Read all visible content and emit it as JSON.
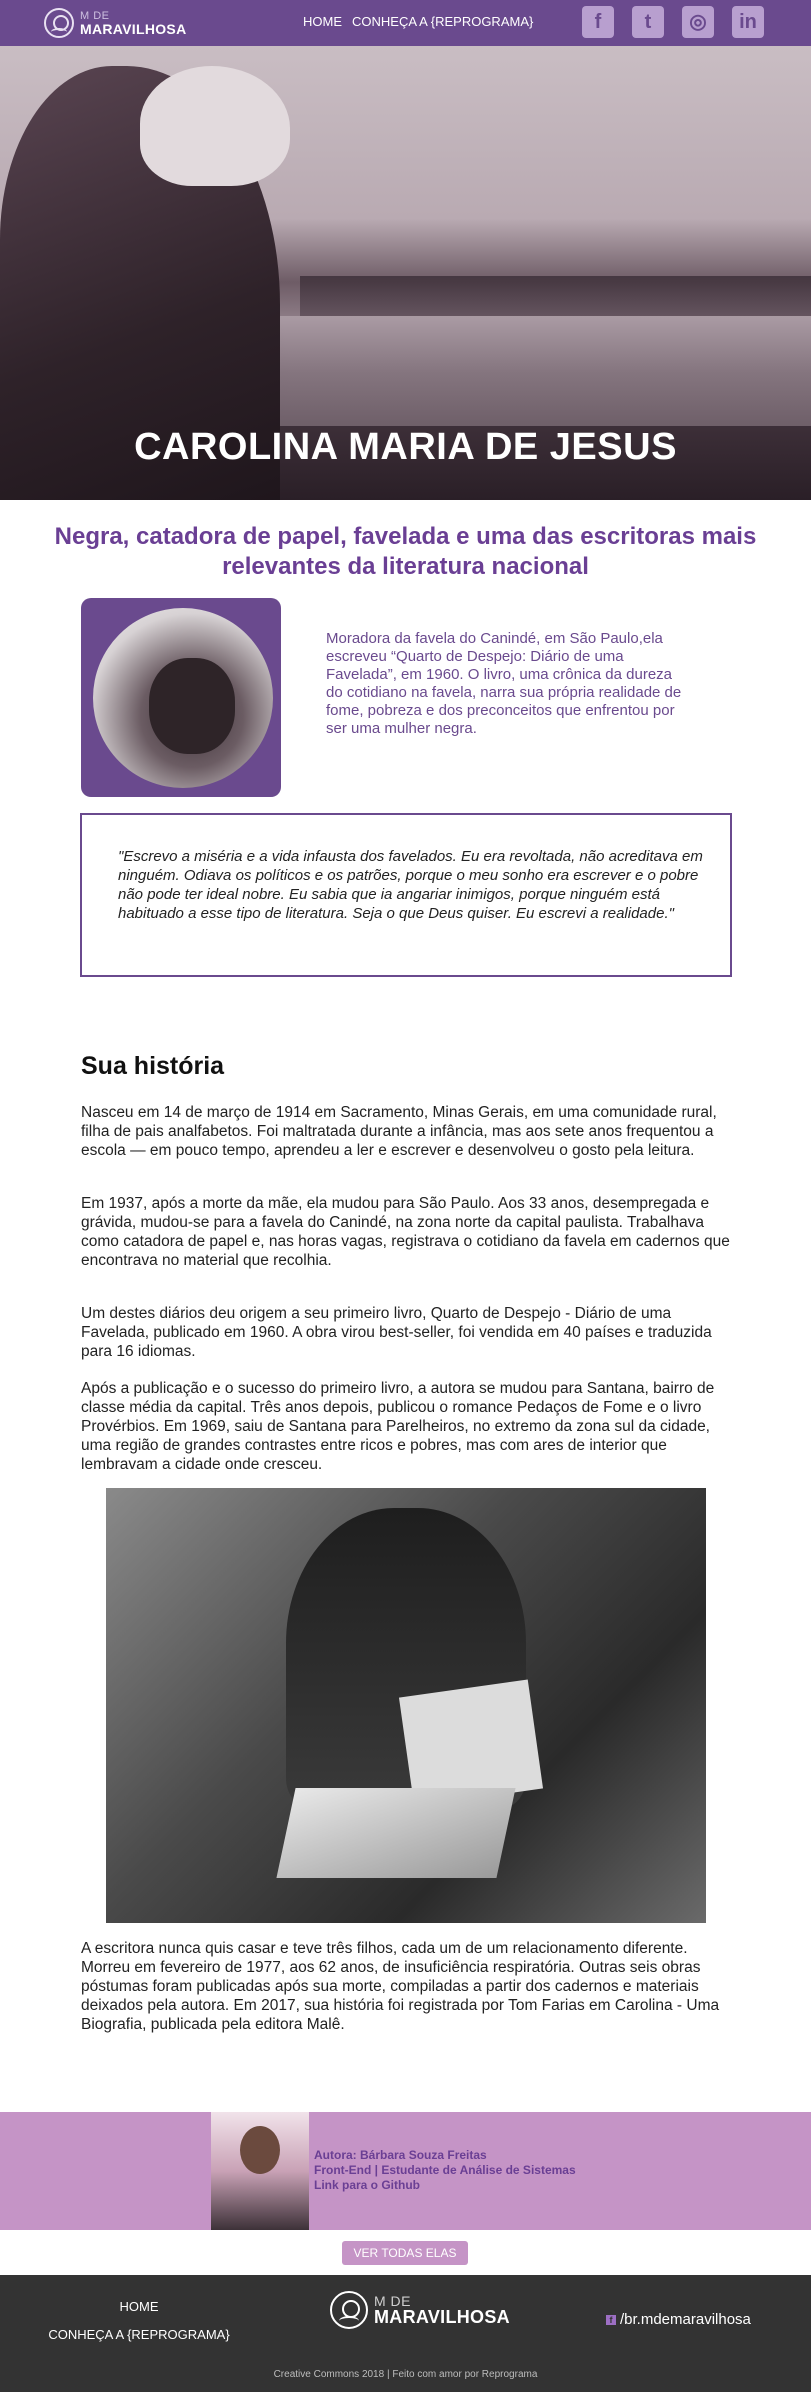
{
  "nav": {
    "logo_small": "M DE",
    "logo_big": "MARAVILHOSA",
    "links": [
      "HOME",
      "CONHEÇA A {REPROGRAMA}"
    ],
    "social_icons": [
      "facebook-icon",
      "twitter-icon",
      "instagram-icon",
      "linkedin-icon"
    ]
  },
  "hero": {
    "title": "CAROLINA MARIA DE JESUS"
  },
  "subtitle": "Negra, catadora de papel, favelada e uma das escritoras mais relevantes da literatura nacional",
  "intro": "Moradora da favela do Canindé, em São Paulo,ela escreveu “Quarto de Despejo: Diário de uma Favelada”, em 1960. O livro, uma crônica da dureza do cotidiano na favela, narra sua própria realidade de fome, pobreza e dos preconceitos que enfrentou por ser uma mulher negra.",
  "quote": "\"Escrevo a miséria e a vida infausta dos favelados. Eu era revoltada, não acreditava em ninguém. Odiava os políticos e os patrões, porque o meu sonho era escrever e o pobre não pode ter ideal nobre. Eu sabia que ia angariar inimigos, porque ninguém está habituado a esse tipo de literatura. Seja o que Deus quiser. Eu escrevi a realidade.\"",
  "history": {
    "title": "Sua história",
    "paragraphs": [
      "Nasceu em 14 de março de 1914 em Sacramento, Minas Gerais, em uma comunidade rural, filha de pais analfabetos. Foi maltratada durante a infância, mas aos sete anos frequentou a escola — em pouco tempo, aprendeu a ler e escrever e desenvolveu o gosto pela leitura.",
      "Em 1937, após a morte da mãe, ela mudou para São Paulo. Aos 33 anos, desempregada e grávida, mudou-se para a favela do Canindé, na zona norte da capital paulista. Trabalhava como catadora de papel e, nas horas vagas, registrava o cotidiano da favela em cadernos que encontrava no material que recolhia.",
      "Um destes diários deu origem a seu primeiro livro, Quarto de Despejo - Diário de uma Favelada, publicado em 1960. A obra virou best-seller, foi vendida em 40 países e traduzida para 16 idiomas.",
      "Após a publicação e o sucesso do primeiro livro, a autora se mudou para Santana, bairro de classe média da capital. Três anos depois, publicou o romance Pedaços de Fome e o livro Provérbios. Em 1969, saiu de Santana para Parelheiros, no extremo da zona sul da cidade, uma região de grandes contrastes entre ricos e pobres, mas com ares de interior que lembravam a cidade onde cresceu.",
      "A escritora nunca quis casar e teve três filhos, cada um de um relacionamento diferente. Morreu em fevereiro de 1977, aos 62 anos, de insuficiência respiratória. Outras seis obras póstumas foram publicadas após sua morte, compiladas a partir dos cadernos e materiais deixados pela autora. Em 2017, sua história foi registrada por Tom Farias em Carolina - Uma Biografia, publicada pela editora Malê."
    ]
  },
  "author": {
    "name": "Autora: Bárbara Souza Freitas",
    "role": "Front-End | Estudante de Análise de Sistemas",
    "link": "Link para o Github"
  },
  "button_all": "VER TODAS ELAS",
  "footer": {
    "links": [
      "HOME",
      "CONHEÇA A {REPROGRAMA}"
    ],
    "logo_small": "M DE",
    "logo_big": "MARAVILHOSA",
    "facebook_icon": "f",
    "social_handle": "/br.mdemaravilhosa",
    "credit": "Creative Commons 2018 | Feito com amor por Reprograma"
  },
  "colors": {
    "primary": "#6a4a8e",
    "accent": "#c594c6",
    "footer": "#333333"
  }
}
